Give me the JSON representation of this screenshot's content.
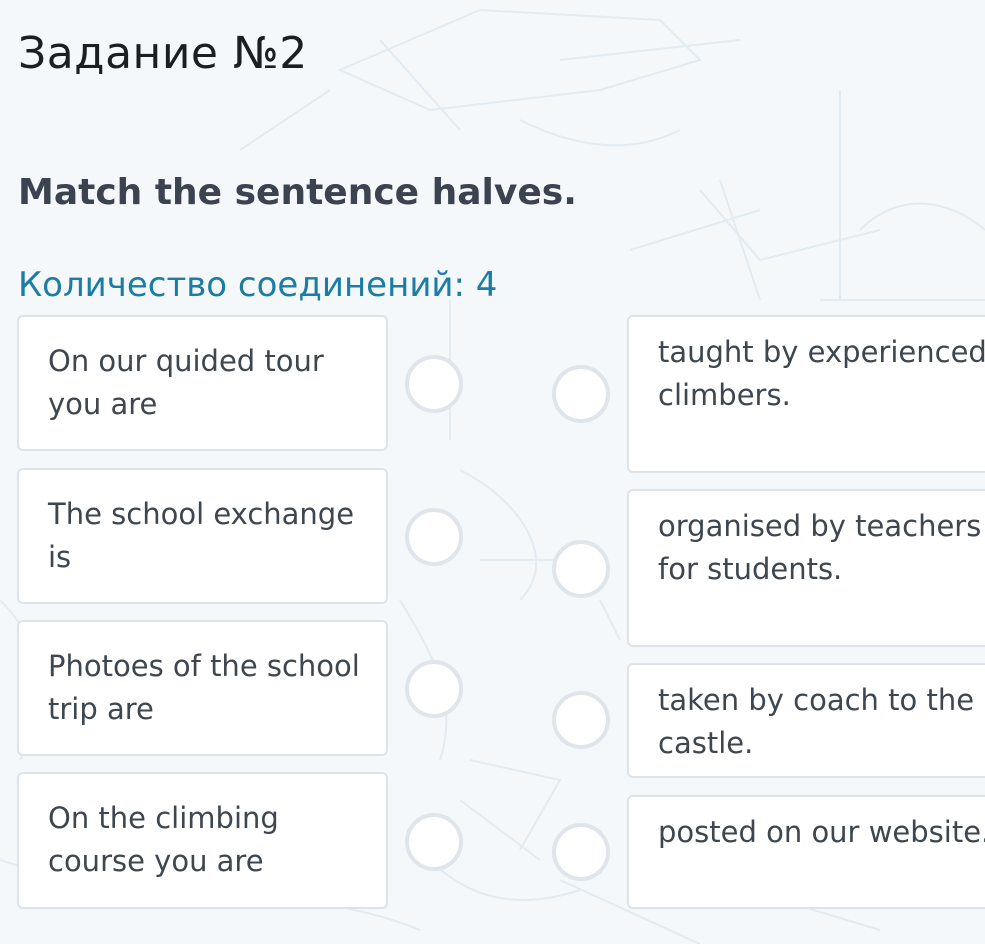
{
  "task": {
    "title": "Задание №2",
    "instruction": "Match the sentence halves.",
    "connections_label": "Количество соединений: 4"
  },
  "left_items": [
    {
      "text": "On our quided tour you are"
    },
    {
      "text": "The school exchange is"
    },
    {
      "text": "Photoes of the school trip are"
    },
    {
      "text": "On the climbing course you are"
    }
  ],
  "right_items": [
    {
      "text": "taught by experienced climbers."
    },
    {
      "text": "organised by teachers for students."
    },
    {
      "text": "taken by coach to the castle."
    },
    {
      "text": "posted on our website."
    }
  ],
  "colors": {
    "accent": "#1b7da4",
    "card_border": "#dde3e8",
    "radio_border": "#dfe5ea",
    "background": "#f4f8fb"
  }
}
